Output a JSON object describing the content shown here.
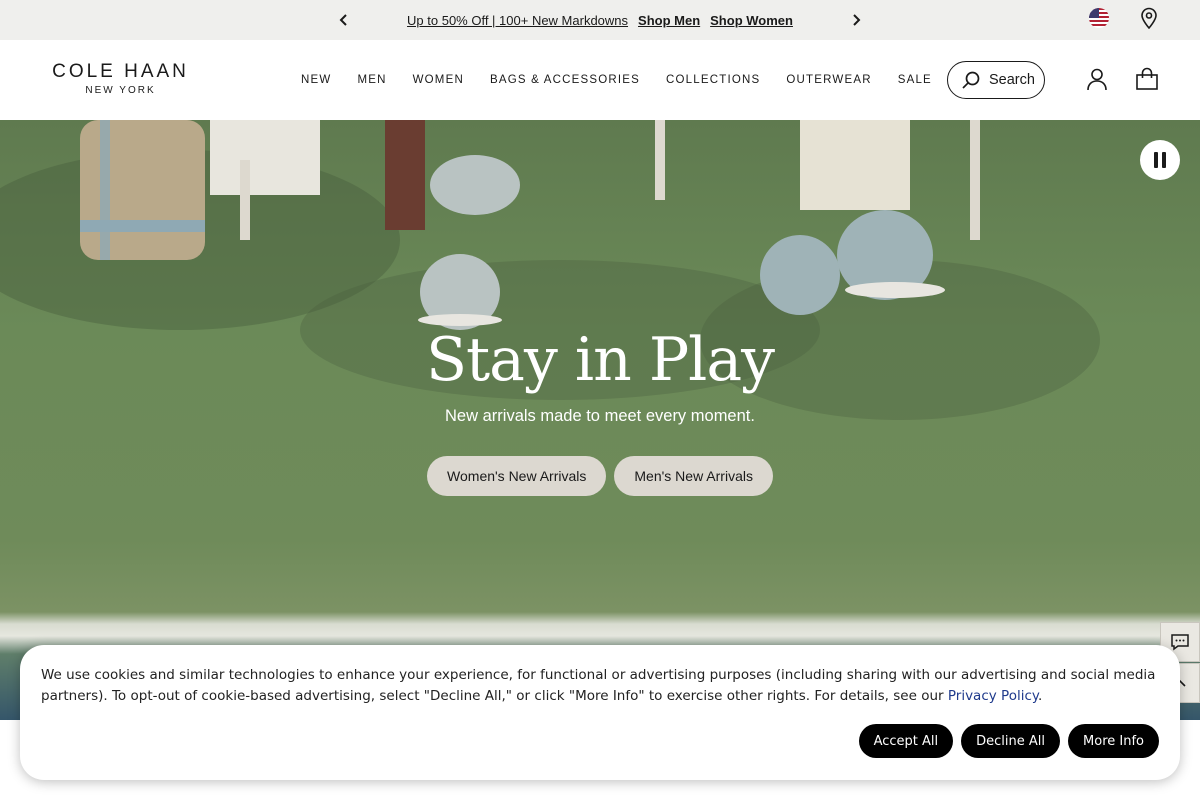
{
  "promo": {
    "text": "Up to 50% Off | 100+ New Markdowns",
    "link_men": "Shop Men",
    "link_women": "Shop Women"
  },
  "header": {
    "logo_main": "COLE HAAN",
    "logo_sub": "NEW YORK",
    "nav": [
      "NEW",
      "MEN",
      "WOMEN",
      "BAGS & ACCESSORIES",
      "COLLECTIONS",
      "OUTERWEAR",
      "SALE"
    ],
    "search_label": "Search"
  },
  "hero": {
    "title": "Stay in Play",
    "subtitle": "New arrivals made to meet every moment.",
    "cta_women": "Women's New Arrivals",
    "cta_men": "Men's New Arrivals"
  },
  "cookie": {
    "text": "We use cookies and similar technologies to enhance your experience, for functional or advertising purposes (including sharing with our advertising and social media partners). To opt-out of cookie-based advertising, select \"Decline All,\" or click \"More Info\" to exercise other rights. For details, see our ",
    "link": "Privacy Policy",
    "end": ".",
    "accept": "Accept All",
    "decline": "Decline All",
    "more": "More Info"
  },
  "colors": {
    "promo_bg": "#efefed",
    "hero_green": "#6b8a58",
    "cta_bg": "#dcd8d0",
    "button_black": "#000000",
    "link_blue": "#1f3a8c"
  },
  "icons": [
    "chevron-left-icon",
    "chevron-right-icon",
    "us-flag-icon",
    "location-pin-icon",
    "search-icon",
    "account-icon",
    "shopping-bag-icon",
    "pause-icon",
    "chat-icon",
    "chevron-up-icon"
  ]
}
